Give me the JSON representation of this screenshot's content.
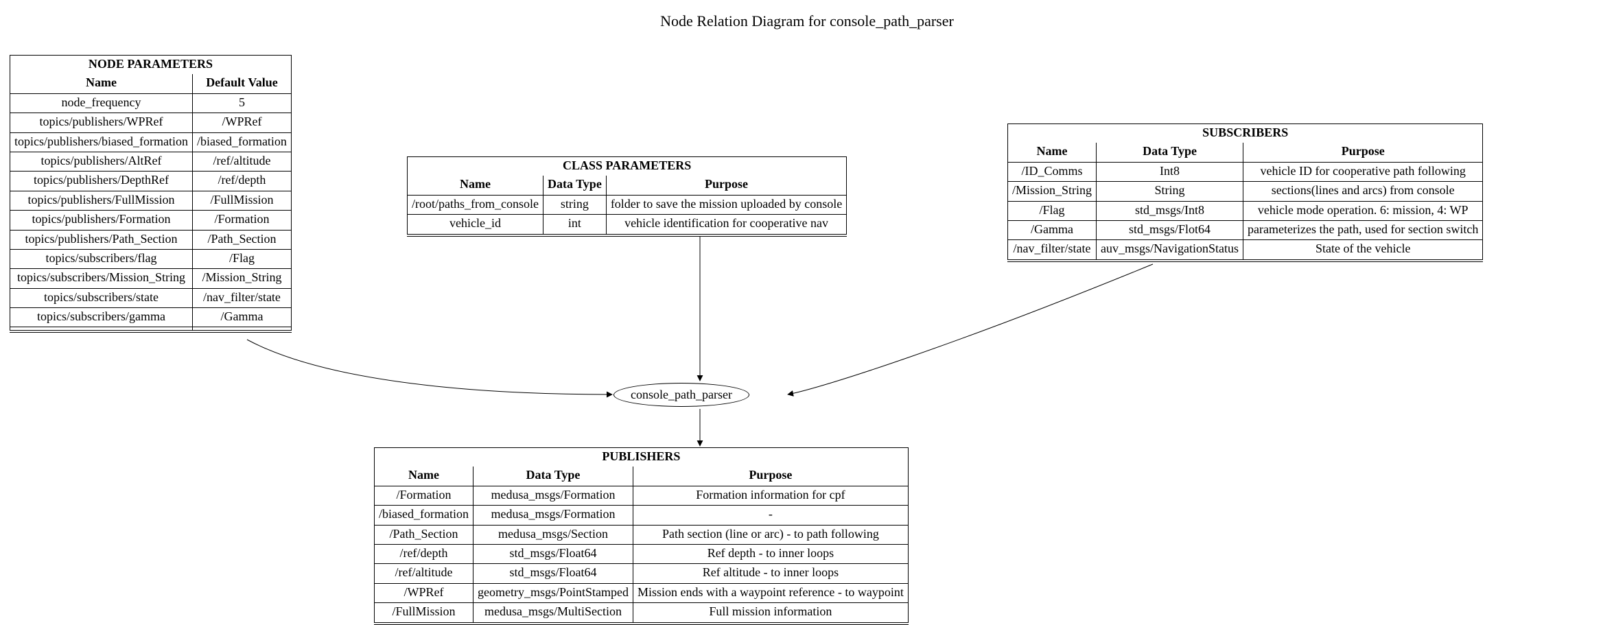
{
  "title": "Node Relation Diagram for console_path_parser",
  "center_node": "console_path_parser",
  "node_params": {
    "title": "NODE PARAMETERS",
    "cols": [
      "Name",
      "Default Value"
    ],
    "rows": [
      {
        "name": "node_frequency",
        "val": "5"
      },
      {
        "name": "topics/publishers/WPRef",
        "val": "/WPRef"
      },
      {
        "name": "topics/publishers/biased_formation",
        "val": "/biased_formation"
      },
      {
        "name": "topics/publishers/AltRef",
        "val": "/ref/altitude"
      },
      {
        "name": "topics/publishers/DepthRef",
        "val": "/ref/depth"
      },
      {
        "name": "topics/publishers/FullMission",
        "val": "/FullMission"
      },
      {
        "name": "topics/publishers/Formation",
        "val": "/Formation"
      },
      {
        "name": "topics/publishers/Path_Section",
        "val": "/Path_Section"
      },
      {
        "name": "topics/subscribers/flag",
        "val": "/Flag"
      },
      {
        "name": "topics/subscribers/Mission_String",
        "val": "/Mission_String"
      },
      {
        "name": "topics/subscribers/state",
        "val": "/nav_filter/state"
      },
      {
        "name": "topics/subscribers/gamma",
        "val": "/Gamma"
      },
      {
        "name": "",
        "val": ""
      }
    ]
  },
  "class_params": {
    "title": "CLASS PARAMETERS",
    "cols": [
      "Name",
      "Data Type",
      "Purpose"
    ],
    "rows": [
      {
        "name": "/root/paths_from_console",
        "type": "string",
        "purpose": "folder to save the mission uploaded by console"
      },
      {
        "name": "vehicle_id",
        "type": "int",
        "purpose": "vehicle identification for cooperative nav"
      }
    ]
  },
  "subscribers": {
    "title": "SUBSCRIBERS",
    "cols": [
      "Name",
      "Data Type",
      "Purpose"
    ],
    "rows": [
      {
        "name": "/ID_Comms",
        "type": "Int8",
        "purpose": "vehicle ID for cooperative path following"
      },
      {
        "name": "/Mission_String",
        "type": "String",
        "purpose": "sections(lines and arcs) from console"
      },
      {
        "name": "/Flag",
        "type": "std_msgs/Int8",
        "purpose": "vehicle mode operation. 6: mission, 4: WP"
      },
      {
        "name": "/Gamma",
        "type": "std_msgs/Flot64",
        "purpose": "parameterizes the path, used for section switch"
      },
      {
        "name": "/nav_filter/state",
        "type": "auv_msgs/NavigationStatus",
        "purpose": "State of the vehicle"
      }
    ]
  },
  "publishers": {
    "title": "PUBLISHERS",
    "cols": [
      "Name",
      "Data Type",
      "Purpose"
    ],
    "rows": [
      {
        "name": "/Formation",
        "type": "medusa_msgs/Formation",
        "purpose": "Formation information for cpf"
      },
      {
        "name": "/biased_formation",
        "type": "medusa_msgs/Formation",
        "purpose": "-"
      },
      {
        "name": "/Path_Section",
        "type": "medusa_msgs/Section",
        "purpose": "Path section (line or arc) - to path following"
      },
      {
        "name": "/ref/depth",
        "type": "std_msgs/Float64",
        "purpose": "Ref depth -  to inner loops"
      },
      {
        "name": "/ref/altitude",
        "type": "std_msgs/Float64",
        "purpose": "Ref altitude - to inner loops"
      },
      {
        "name": "/WPRef",
        "type": "geometry_msgs/PointStamped",
        "purpose": "Mission ends with a waypoint reference - to waypoint"
      },
      {
        "name": "/FullMission",
        "type": "medusa_msgs/MultiSection",
        "purpose": "Full mission information"
      }
    ]
  },
  "chart_data": {
    "type": "diagram",
    "title": "Node Relation Diagram for console_path_parser",
    "center": "console_path_parser",
    "edges": [
      {
        "from": "NODE PARAMETERS",
        "to": "console_path_parser"
      },
      {
        "from": "CLASS PARAMETERS",
        "to": "console_path_parser"
      },
      {
        "from": "SUBSCRIBERS",
        "to": "console_path_parser"
      },
      {
        "from": "console_path_parser",
        "to": "PUBLISHERS"
      }
    ],
    "boxes": {
      "NODE PARAMETERS": {
        "columns": [
          "Name",
          "Default Value"
        ],
        "rows": 13
      },
      "CLASS PARAMETERS": {
        "columns": [
          "Name",
          "Data Type",
          "Purpose"
        ],
        "rows": 2
      },
      "SUBSCRIBERS": {
        "columns": [
          "Name",
          "Data Type",
          "Purpose"
        ],
        "rows": 5
      },
      "PUBLISHERS": {
        "columns": [
          "Name",
          "Data Type",
          "Purpose"
        ],
        "rows": 7
      }
    }
  }
}
